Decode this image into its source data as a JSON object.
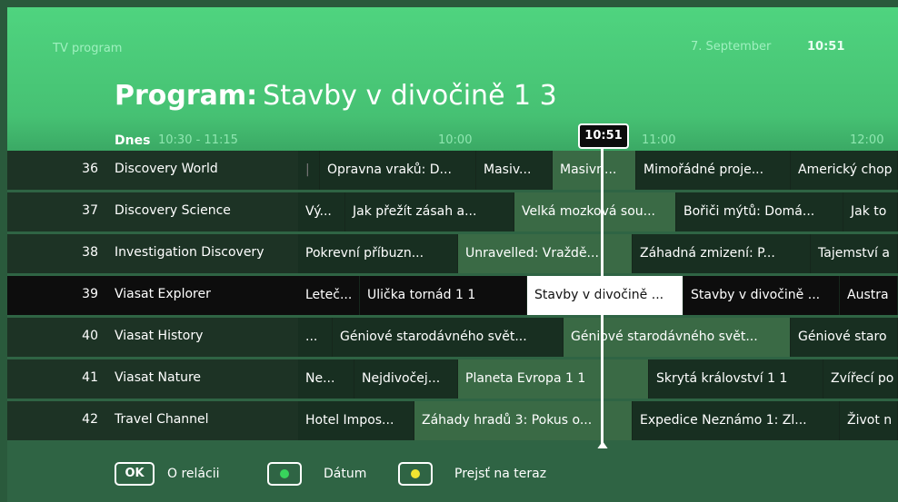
{
  "header": {
    "app_title": "TV program",
    "date": "7. September",
    "time": "10:51",
    "heading_bold": "Program:",
    "heading_name": "Stavby v divočině 1 3",
    "today_label": "Dnes",
    "today_range": "10:30 - 11:15"
  },
  "timeline": {
    "ticks": [
      "10:00",
      "11:00",
      "12:00"
    ],
    "now": "10:51"
  },
  "channels": [
    {
      "num": "36",
      "name": "Discovery World"
    },
    {
      "num": "37",
      "name": "Discovery Science"
    },
    {
      "num": "38",
      "name": "Investigation Discovery"
    },
    {
      "num": "39",
      "name": "Viasat Explorer"
    },
    {
      "num": "40",
      "name": "Viasat History"
    },
    {
      "num": "41",
      "name": "Viasat Nature"
    },
    {
      "num": "42",
      "name": "Travel Channel"
    }
  ],
  "programs": {
    "r36": [
      "|",
      "Opravna vraků: D...",
      "Masiv...",
      "Masivn...",
      "Mimořádné proje...",
      "Americký chop"
    ],
    "r37": [
      "Vý...",
      "Jak přežít zásah a...",
      "Velká mozková sou...",
      "Bořiči mýtů: Domá...",
      "Jak to"
    ],
    "r38": [
      "Pokrevní příbuzn...",
      "Unravelled: Vraždě...",
      "Záhadná zmizení: P...",
      "Tajemství a"
    ],
    "r39": [
      "Leteč...",
      "Ulička tornád 1 1",
      "Stavby v divočině ...",
      "Stavby v divočině ...",
      "Austra"
    ],
    "r40": [
      "...",
      "Géniové starodávného svět...",
      "Géniové starodávného svět...",
      "Géniové staro"
    ],
    "r41": [
      "Ne...",
      "Nejdivočej...",
      "Planeta Evropa 1 1",
      "Skrytá království 1 1",
      "Zvířecí po"
    ],
    "r42": [
      "Hotel Impos...",
      "Záhady hradů 3: Pokus o...",
      "Expedice Neznámo 1: Zl...",
      "Život n"
    ]
  },
  "footer": {
    "ok_key": "OK",
    "ok_label": "O relácii",
    "date_label": "Dátum",
    "now_label": "Prejsť na teraz"
  },
  "colors": {
    "green_dot": "#38d45c",
    "yellow_dot": "#f2e531",
    "accent": "#4fd47f"
  }
}
